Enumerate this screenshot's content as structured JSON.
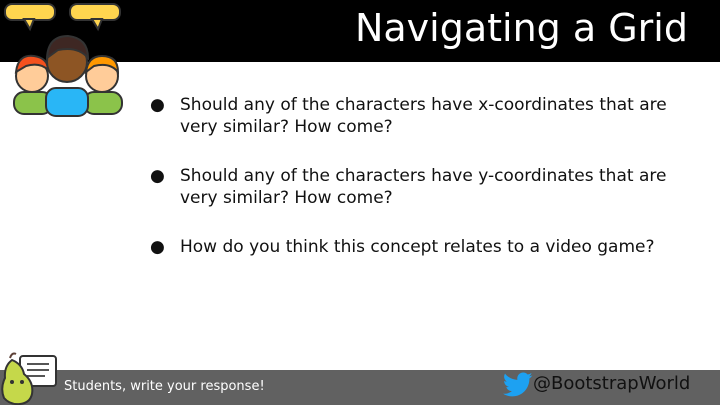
{
  "slide": {
    "title": "Navigating a Grid",
    "bullets": [
      "Should any of the characters have x-coordinates that are very similar? How come?",
      "Should any of the characters have y-coordinates that are very similar? How come?",
      "How do you think this concept relates to a video game?"
    ],
    "bullet_glyph": "●"
  },
  "footer": {
    "prompt": "Students, write your response!",
    "twitter_handle": "@BootstrapWorld"
  },
  "colors": {
    "header_bg": "#000000",
    "footer_bg": "#616161",
    "speech_bubble": "#ffd54f",
    "twitter_blue": "#1da1f2",
    "pear_green": "#c5d84a"
  },
  "icons": {
    "header": "three-people-speech-bubbles-icon",
    "pear": "pear-deck-icon",
    "twitter": "twitter-bird-icon"
  }
}
